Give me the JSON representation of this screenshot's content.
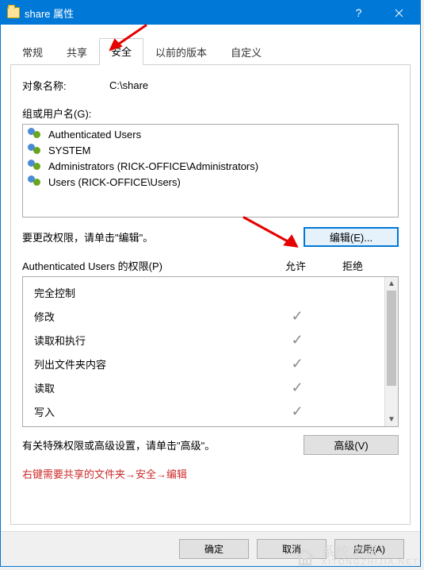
{
  "window": {
    "title": "share 属性",
    "help_tip": "?",
    "close_tip": "×"
  },
  "tabs": [
    {
      "label": "常规",
      "active": false
    },
    {
      "label": "共享",
      "active": false
    },
    {
      "label": "安全",
      "active": true
    },
    {
      "label": "以前的版本",
      "active": false
    },
    {
      "label": "自定义",
      "active": false
    }
  ],
  "object": {
    "label": "对象名称:",
    "path": "C:\\share"
  },
  "group_label": "组或用户名(G):",
  "groups": [
    {
      "name": "Authenticated Users"
    },
    {
      "name": "SYSTEM"
    },
    {
      "name": "Administrators (RICK-OFFICE\\Administrators)"
    },
    {
      "name": "Users (RICK-OFFICE\\Users)"
    }
  ],
  "edit_hint": "要更改权限，请单击\"编辑\"。",
  "edit_button": "编辑(E)...",
  "perm_header_left": "Authenticated Users 的权限(P)",
  "perm_header_allow": "允许",
  "perm_header_deny": "拒绝",
  "permissions": [
    {
      "name": "完全控制",
      "allow": false,
      "deny": false
    },
    {
      "name": "修改",
      "allow": true,
      "deny": false
    },
    {
      "name": "读取和执行",
      "allow": true,
      "deny": false
    },
    {
      "name": "列出文件夹内容",
      "allow": true,
      "deny": false
    },
    {
      "name": "读取",
      "allow": true,
      "deny": false
    },
    {
      "name": "写入",
      "allow": true,
      "deny": false
    }
  ],
  "adv_hint": "有关特殊权限或高级设置，请单击\"高级\"。",
  "adv_button": "高级(V)",
  "tutorial_note": "右键需要共享的文件夹→安全→编辑",
  "footer": {
    "ok": "确定",
    "cancel": "取消",
    "apply": "应用(A)"
  },
  "watermark": {
    "line1": "系统之家",
    "line2": "XITONGZHIJIA.NET"
  }
}
